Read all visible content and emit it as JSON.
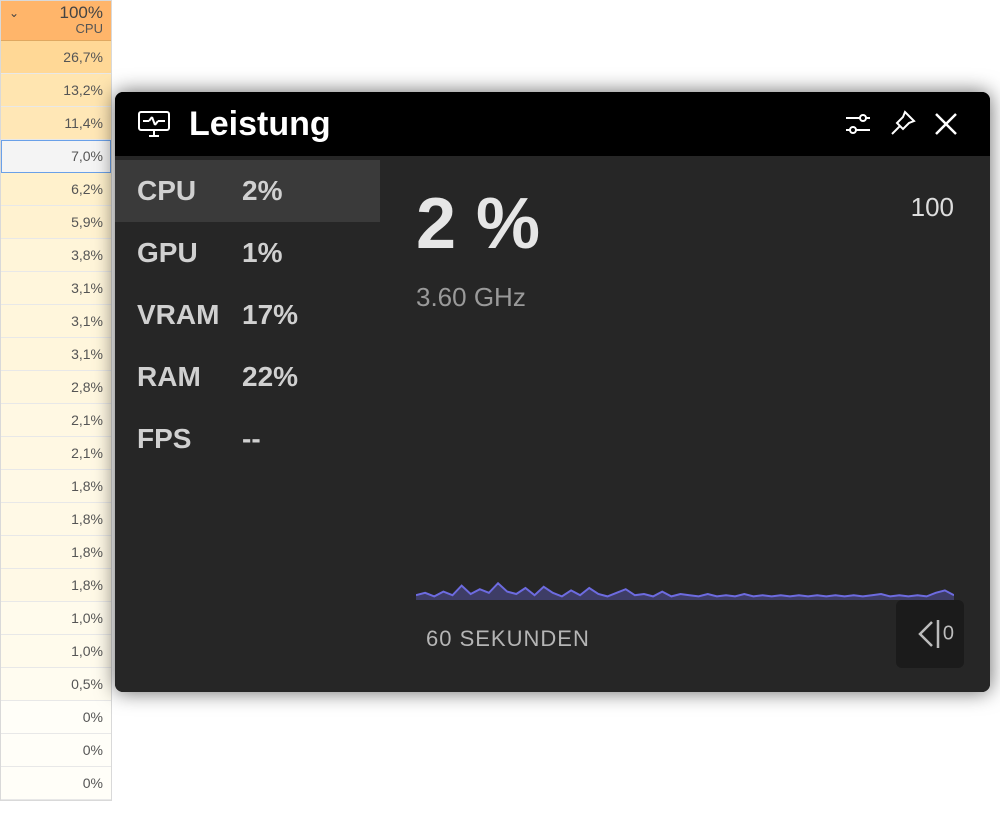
{
  "cpu_column": {
    "header_pct": "100%",
    "header_label": "CPU",
    "rows": [
      {
        "text": "26,7%",
        "bg": "#ffd896"
      },
      {
        "text": "13,2%",
        "bg": "#ffe5b0"
      },
      {
        "text": "11,4%",
        "bg": "#ffe7b6"
      },
      {
        "text": "7,0%",
        "bg": "#f4f4f4",
        "selected": true
      },
      {
        "text": "6,2%",
        "bg": "#fff1cc"
      },
      {
        "text": "5,9%",
        "bg": "#fff2d0"
      },
      {
        "text": "3,8%",
        "bg": "#fff5d9"
      },
      {
        "text": "3,1%",
        "bg": "#fff6dc"
      },
      {
        "text": "3,1%",
        "bg": "#fff6dc"
      },
      {
        "text": "3,1%",
        "bg": "#fff6dc"
      },
      {
        "text": "2,8%",
        "bg": "#fff7df"
      },
      {
        "text": "2,1%",
        "bg": "#fff8e3"
      },
      {
        "text": "2,1%",
        "bg": "#fff8e3"
      },
      {
        "text": "1,8%",
        "bg": "#fff9e6"
      },
      {
        "text": "1,8%",
        "bg": "#fff9e6"
      },
      {
        "text": "1,8%",
        "bg": "#fff9e6"
      },
      {
        "text": "1,8%",
        "bg": "#fff9e6"
      },
      {
        "text": "1,0%",
        "bg": "#fffbec"
      },
      {
        "text": "1,0%",
        "bg": "#fffbec"
      },
      {
        "text": "0,5%",
        "bg": "#fffcf0"
      },
      {
        "text": "0%",
        "bg": "#fffef8"
      },
      {
        "text": "0%",
        "bg": "#fffef8"
      },
      {
        "text": "0%",
        "bg": "#fffef8"
      }
    ]
  },
  "overlay": {
    "title": "Leistung",
    "metrics": [
      {
        "name": "CPU",
        "value": "2%",
        "active": true
      },
      {
        "name": "GPU",
        "value": "1%",
        "active": false
      },
      {
        "name": "VRAM",
        "value": "17%",
        "active": false
      },
      {
        "name": "RAM",
        "value": "22%",
        "active": false
      },
      {
        "name": "FPS",
        "value": "--",
        "active": false
      }
    ],
    "big_value": "2 %",
    "frequency": "3.60 GHz",
    "y_max_label": "100",
    "x_axis_label": "60 SEKUNDEN",
    "snap_label": "0"
  },
  "chart_data": {
    "type": "area",
    "title": "CPU usage",
    "xlabel": "60 SEKUNDEN",
    "ylabel": "",
    "ylim": [
      0,
      100
    ],
    "x_seconds": 60,
    "color": "#6d6be0",
    "values": [
      4,
      6,
      3,
      7,
      4,
      12,
      5,
      9,
      6,
      14,
      7,
      5,
      10,
      4,
      11,
      6,
      3,
      8,
      4,
      10,
      5,
      3,
      6,
      9,
      4,
      5,
      3,
      7,
      3,
      5,
      4,
      3,
      5,
      3,
      4,
      3,
      5,
      3,
      4,
      3,
      4,
      3,
      4,
      3,
      4,
      3,
      4,
      3,
      4,
      3,
      4,
      5,
      3,
      4,
      3,
      4,
      3,
      6,
      8,
      4
    ]
  }
}
